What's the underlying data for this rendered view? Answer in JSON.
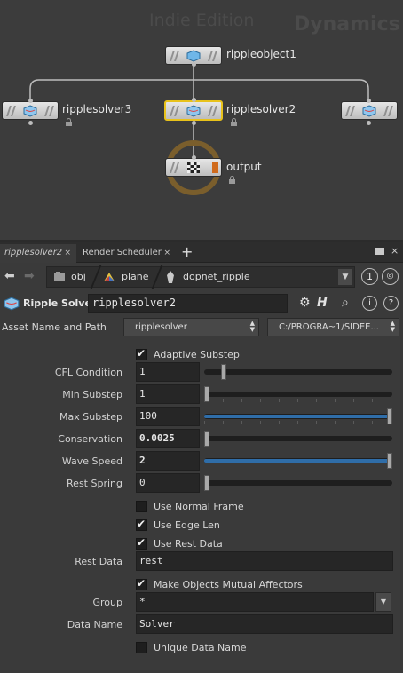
{
  "network": {
    "watermark_edition": "Indie Edition",
    "watermark_context": "Dynamics",
    "nodes": {
      "top": "rippleobject1",
      "left": "ripplesolver3",
      "center": "ripplesolver2",
      "right": "",
      "output": "output"
    }
  },
  "tabs": {
    "active": "ripplesolver2",
    "second": "Render Scheduler",
    "close_glyph": "×",
    "add_glyph": "+"
  },
  "pathbar": {
    "crumbs": [
      "obj",
      "plane",
      "dopnet_ripple"
    ],
    "history_number": "1"
  },
  "header": {
    "op_type": "Ripple Solver",
    "node_name": "ripplesolver2"
  },
  "asset": {
    "label": "Asset Name and Path",
    "name": "ripplesolver",
    "path": "C:/PROGRA~1/SIDEE..."
  },
  "params": {
    "adaptive_substep": {
      "label": "Adaptive Substep",
      "checked": true
    },
    "cfl_condition": {
      "label": "CFL Condition",
      "value": "1"
    },
    "min_substep": {
      "label": "Min Substep",
      "value": "1"
    },
    "max_substep": {
      "label": "Max Substep",
      "value": "100"
    },
    "conservation": {
      "label": "Conservation",
      "value": "0.0025"
    },
    "wave_speed": {
      "label": "Wave Speed",
      "value": "2"
    },
    "rest_spring": {
      "label": "Rest Spring",
      "value": "0"
    },
    "use_normal_frame": {
      "label": "Use Normal Frame",
      "checked": false
    },
    "use_edge_len": {
      "label": "Use Edge Len",
      "checked": true
    },
    "use_rest_data": {
      "label": "Use Rest Data",
      "checked": true
    },
    "rest_data": {
      "label": "Rest Data",
      "value": "rest"
    },
    "mutual_affectors": {
      "label": "Make Objects Mutual Affectors",
      "checked": true
    },
    "group": {
      "label": "Group",
      "value": "*"
    },
    "data_name": {
      "label": "Data Name",
      "value": "Solver"
    },
    "unique_data_name": {
      "label": "Unique Data Name",
      "checked": false
    }
  },
  "colors": {
    "selected_node": "#e8c21b",
    "slider_fill": "#2f6da8",
    "output_flag": "#d06b1c"
  }
}
